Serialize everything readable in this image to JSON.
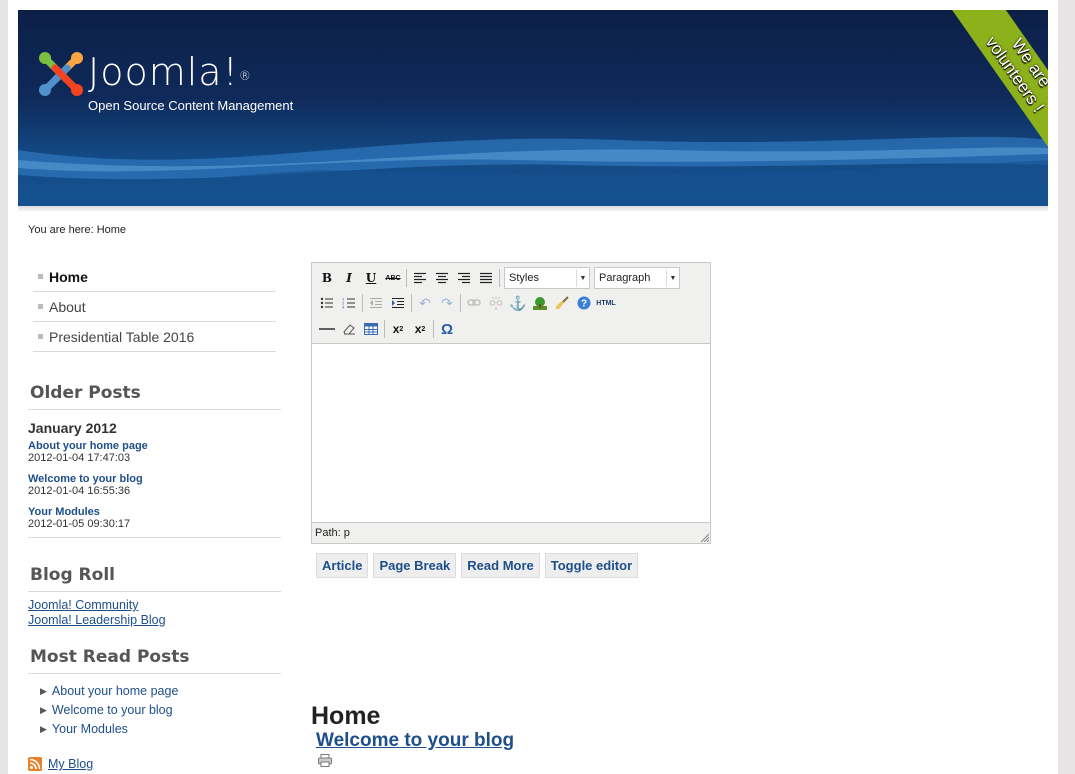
{
  "header": {
    "logo_text": "Joomla!",
    "logo_reg": "®",
    "tagline": "Open Source Content Management",
    "ribbon_line1": "We are",
    "ribbon_line2": "volunteers !",
    "colors": {
      "banner": "#0f2a5a",
      "ribbon": "#8db11a"
    }
  },
  "breadcrumb": "You are here: Home",
  "menu": {
    "items": [
      {
        "label": "Home",
        "active": true
      },
      {
        "label": "About"
      },
      {
        "label": "Presidential Table 2016"
      }
    ]
  },
  "older_posts": {
    "title": "Older Posts",
    "month": "January 2012",
    "posts": [
      {
        "title": "About your home page",
        "date": "2012-01-04 17:47:03"
      },
      {
        "title": "Welcome to your blog",
        "date": "2012-01-04 16:55:36"
      },
      {
        "title": "Your Modules",
        "date": "2012-01-05 09:30:17"
      }
    ]
  },
  "blog_roll": {
    "title": "Blog Roll",
    "links": [
      "Joomla! Community",
      "Joomla! Leadership Blog"
    ]
  },
  "most_read": {
    "title": "Most Read Posts",
    "items": [
      "About your home page",
      "Welcome to your blog",
      "Your Modules"
    ]
  },
  "feed": {
    "label": "My Blog"
  },
  "editor": {
    "styles_select": "Styles",
    "format_select": "Paragraph",
    "status_path": "Path: p",
    "toolbar": {
      "bold": "B",
      "italic": "I",
      "underline": "U",
      "strike": "ABC",
      "html": "HTML",
      "omega": "Ω"
    }
  },
  "editor_buttons": [
    "Article",
    "Page Break",
    "Read More",
    "Toggle editor"
  ],
  "content": {
    "heading": "Home",
    "article_title": "Welcome to your blog"
  }
}
